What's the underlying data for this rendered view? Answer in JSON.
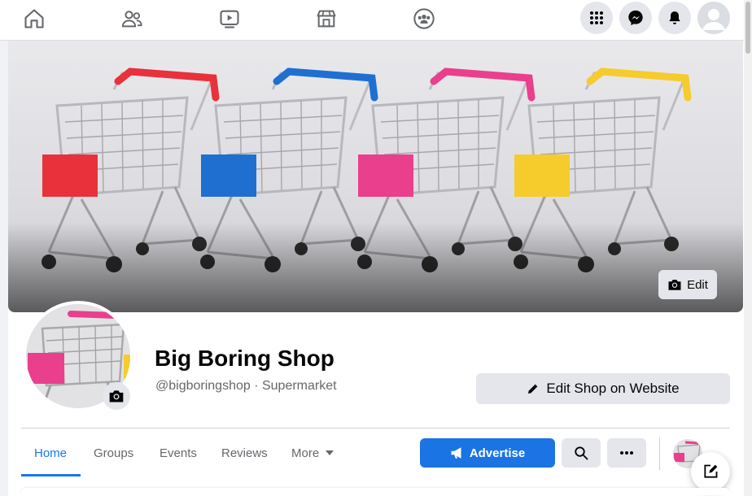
{
  "topbar": {
    "nav_icons": [
      "home-icon",
      "friends-icon",
      "watch-icon",
      "marketplace-icon",
      "groups-icon"
    ],
    "right_icons": [
      "menu-grid-icon",
      "messenger-icon",
      "notifications-icon",
      "account-avatar"
    ]
  },
  "cover": {
    "edit_label": "Edit",
    "cart_colors": [
      "#e8313b",
      "#1f6fd1",
      "#ea3f8c",
      "#f6cb2c"
    ]
  },
  "page": {
    "name": "Big Boring Shop",
    "handle": "@bigboringshop · Supermarket",
    "edit_site_label": "Edit Shop on Website"
  },
  "tabs": [
    {
      "label": "Home",
      "active": true
    },
    {
      "label": "Groups"
    },
    {
      "label": "Events"
    },
    {
      "label": "Reviews"
    },
    {
      "label": "More"
    }
  ],
  "actions": {
    "advertise_label": "Advertise"
  },
  "colors": {
    "accent": "#1877f2",
    "button_bg": "#e4e6eb",
    "text_secondary": "#65676b"
  }
}
